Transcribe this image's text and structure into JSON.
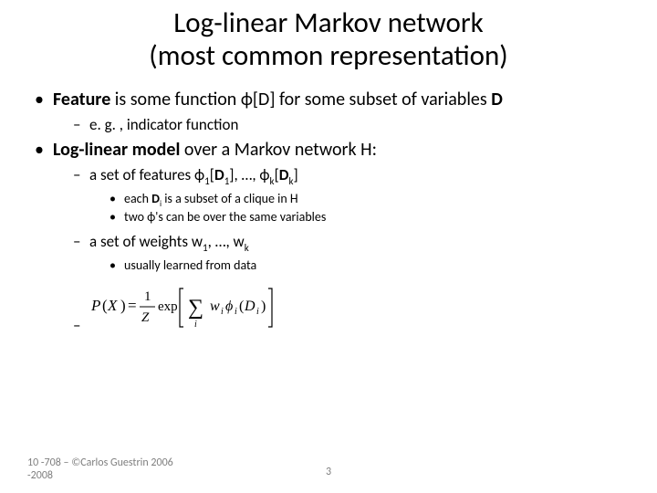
{
  "title_l1": "Log-linear Markov network",
  "title_l2": "(most common representation)",
  "b1_pre": "Feature",
  "b1_rest": " is some function ϕ[D] for some subset of variables ",
  "b1_D": "D",
  "b1_1": "e. g. , indicator function",
  "b2_pre": "Log-linear model",
  "b2_rest": " over a Markov network H:",
  "b2_1_a": "a set of features ϕ",
  "b2_1_b": "[",
  "b2_1_D1": "D",
  "b2_1_c": "], …, ϕ",
  "b2_1_d": "[",
  "b2_1_Dk": "D",
  "b2_1_e": "]",
  "b2_1_1_a": "each ",
  "b2_1_1_b": "D",
  "b2_1_1_c": " is a subset of a clique in H",
  "b2_1_2": "two ϕ's can be over the same variables",
  "b2_2_a": "a set of weights w",
  "b2_2_b": ", …, w",
  "b2_2_1": "usually learned from data",
  "footer_left_l1": "10 -708 – ©Carlos Guestrin 2006",
  "footer_left_l2": "-2008",
  "page_num": "3"
}
